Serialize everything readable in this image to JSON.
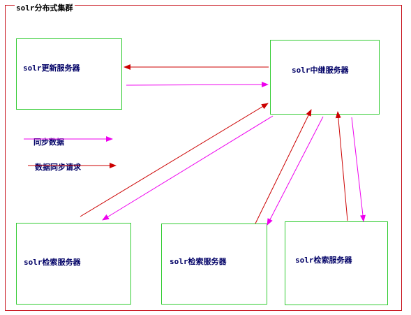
{
  "diagram": {
    "title": "solr分布式集群",
    "nodes": {
      "update": "solr更新服务器",
      "relay": "solr中继服务器",
      "search1": "solr检索服务器",
      "search2": "solr检索服务器",
      "search3": "solr检索服务器"
    },
    "legend": {
      "sync": "同步数据",
      "request": "数据同步请求"
    },
    "colors": {
      "sync": "#ee00ee",
      "request": "#cc0000",
      "frame": "#c8141e",
      "box": "#33cc33"
    }
  }
}
